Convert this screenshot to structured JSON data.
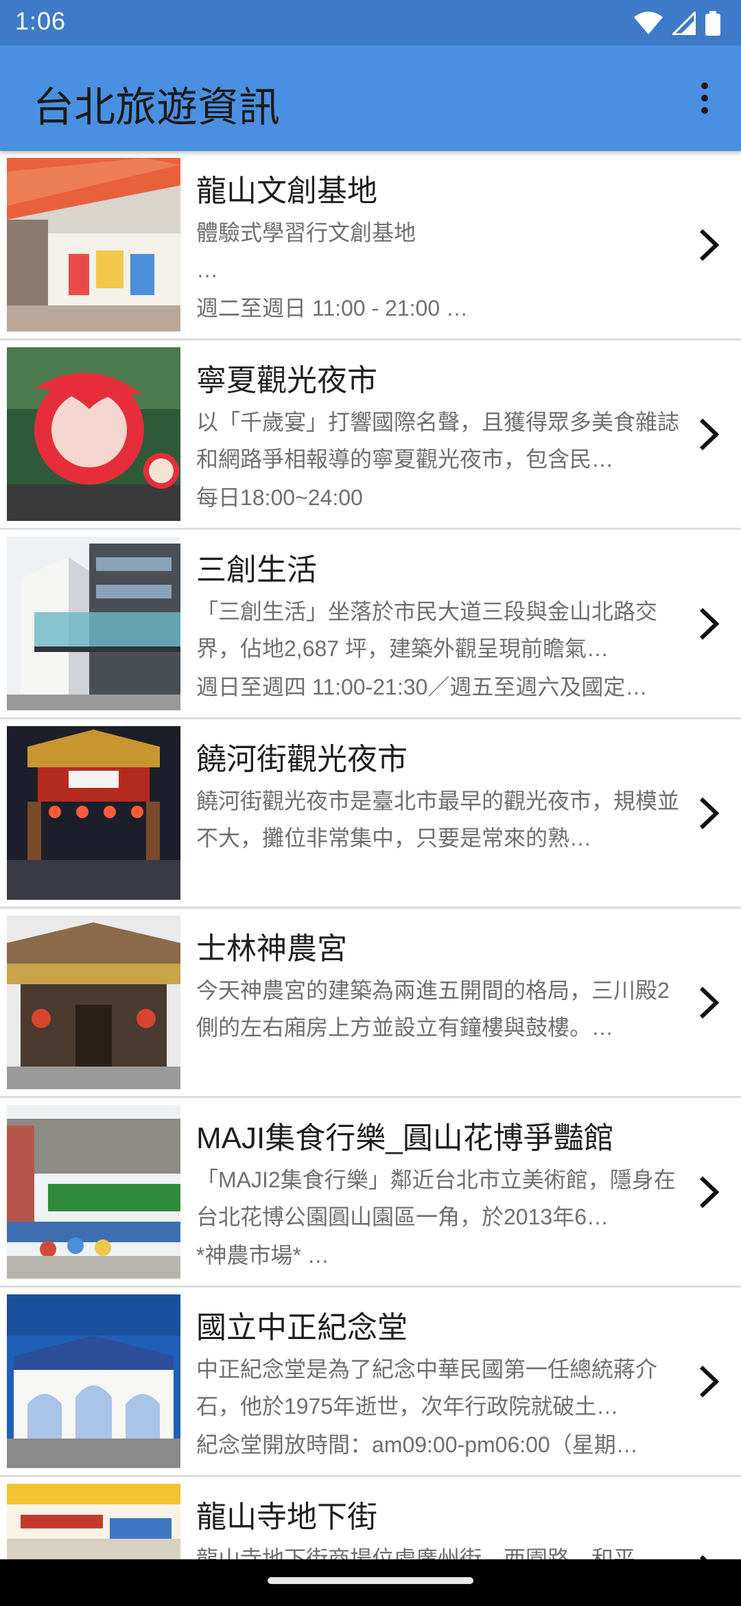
{
  "status_bar": {
    "time": "1:06"
  },
  "app_bar": {
    "title": "台北旅遊資訊"
  },
  "attractions": [
    {
      "title": "龍山文創基地",
      "description": "體驗式學習行文創基地\n …",
      "extra": "週二至週日 11:00 - 21:00     …"
    },
    {
      "title": "寧夏觀光夜市",
      "description": "以「千歲宴」打響國際名聲，且獲得眾多美食雜誌和網路爭相報導的寧夏觀光夜市，包含民…",
      "extra": "每日18:00~24:00"
    },
    {
      "title": "三創生活",
      "description": "「三創生活」坐落於市民大道三段與金山北路交界，佔地2,687 坪，建築外觀呈現前瞻氣…",
      "extra": "週日至週四 11:00-21:30／週五至週六及國定…"
    },
    {
      "title": "饒河街觀光夜市",
      "description": "饒河街觀光夜市是臺北市最早的觀光夜市，規模並不大，攤位非常集中，只要是常來的熟…",
      "extra": ""
    },
    {
      "title": "士林神農宮",
      "description": "今天神農宮的建築為兩進五開間的格局，三川殿2側的左右廂房上方並設立有鐘樓與鼓樓。…",
      "extra": ""
    },
    {
      "title": "MAJI集食行樂_圓山花博爭豔館",
      "description": "「MAJI2集食行樂」鄰近台北市立美術館，隱身在台北花博公園圓山園區一角，於2013年6…",
      "extra": "*神農市場* …"
    },
    {
      "title": "國立中正紀念堂",
      "description": "中正紀念堂是為了紀念中華民國第一任總統蔣介石，他於1975年逝世，次年行政院就破土…",
      "extra": "紀念堂開放時間：am09:00-pm06:00（星期…"
    },
    {
      "title": "龍山寺地下街",
      "description": "龍山寺地下街商場位處廣州街、西園路、和平…",
      "extra": ""
    }
  ]
}
